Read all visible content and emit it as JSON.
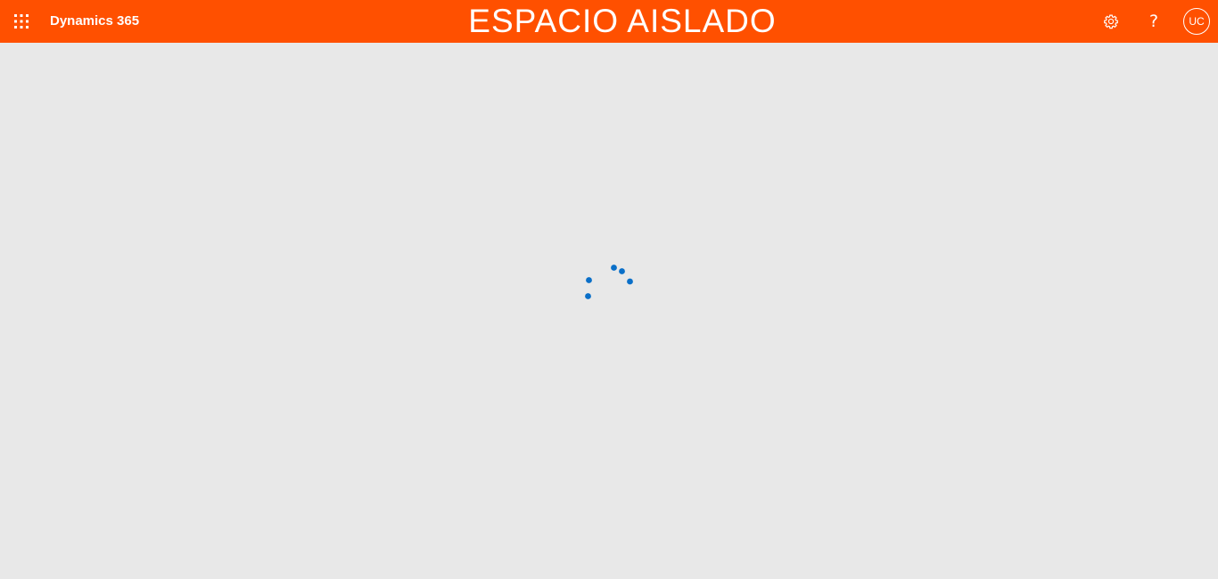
{
  "header": {
    "app_launcher_icon": "waffle-grid-icon",
    "brand_label": "Dynamics 365",
    "environment_title": "ESPACIO AISLADO",
    "settings_icon": "gear-icon",
    "help_label": "?",
    "avatar_initials": "UC"
  },
  "main": {
    "loading_indicator": "loading-spinner-icon"
  },
  "colors": {
    "header_background": "#ff5000",
    "page_background": "#e8e8e8",
    "spinner_dots": "#0a6fc8"
  }
}
